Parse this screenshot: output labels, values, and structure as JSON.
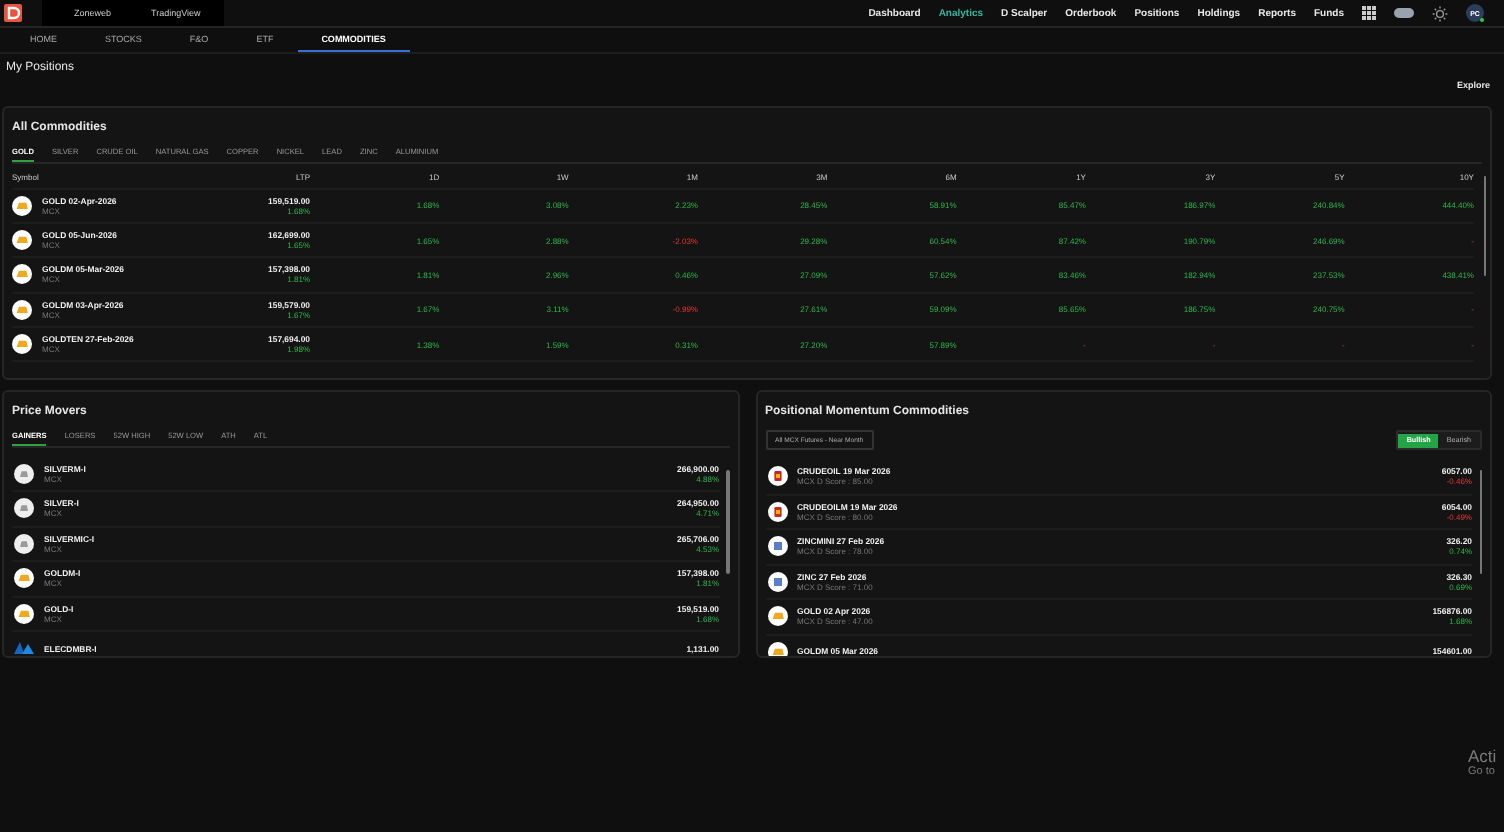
{
  "top_bar": {
    "sites": [
      "Zoneweb",
      "TradingView"
    ],
    "nav": [
      {
        "label": "Dashboard",
        "selected": false
      },
      {
        "label": "Analytics",
        "selected": true
      },
      {
        "label": "D Scalper",
        "selected": false
      },
      {
        "label": "Orderbook",
        "selected": false
      },
      {
        "label": "Positions",
        "selected": false
      },
      {
        "label": "Holdings",
        "selected": false
      },
      {
        "label": "Reports",
        "selected": false
      },
      {
        "label": "Funds",
        "selected": false
      }
    ],
    "avatar": "PC"
  },
  "sub_nav": [
    {
      "label": "HOME",
      "selected": false
    },
    {
      "label": "STOCKS",
      "selected": false
    },
    {
      "label": "F&O",
      "selected": false
    },
    {
      "label": "ETF",
      "selected": false
    },
    {
      "label": "COMMODITIES",
      "selected": true
    }
  ],
  "positions": {
    "title": "My Positions",
    "action": "Explore"
  },
  "all_commodities": {
    "title": "All Commodities",
    "tabs": [
      {
        "label": "GOLD",
        "selected": true
      },
      {
        "label": "SILVER",
        "selected": false
      },
      {
        "label": "CRUDE OIL",
        "selected": false
      },
      {
        "label": "NATURAL GAS",
        "selected": false
      },
      {
        "label": "COPPER",
        "selected": false
      },
      {
        "label": "NICKEL",
        "selected": false
      },
      {
        "label": "LEAD",
        "selected": false
      },
      {
        "label": "ZINC",
        "selected": false
      },
      {
        "label": "ALUMINIUM",
        "selected": false
      }
    ],
    "columns": [
      "Symbol",
      "LTP",
      "1D",
      "1W",
      "1M",
      "3M",
      "6M",
      "1Y",
      "3Y",
      "5Y",
      "10Y"
    ],
    "rows": [
      {
        "kind": "gold",
        "symbol": "GOLD 02-Apr-2026",
        "exchange": "MCX",
        "ltp": "159,519.00",
        "ltp_change": {
          "text": "1.68%",
          "kind": "gain"
        },
        "values": [
          {
            "text": "1.68%",
            "kind": "gain"
          },
          {
            "text": "3.08%",
            "kind": "gain"
          },
          {
            "text": "2.23%",
            "kind": "gain"
          },
          {
            "text": "28.45%",
            "kind": "gain"
          },
          {
            "text": "58.91%",
            "kind": "gain"
          },
          {
            "text": "85.47%",
            "kind": "gain"
          },
          {
            "text": "186.97%",
            "kind": "gain"
          },
          {
            "text": "240.84%",
            "kind": "gain"
          },
          {
            "text": "444.40%",
            "kind": "gain"
          }
        ]
      },
      {
        "kind": "gold",
        "symbol": "GOLD 05-Jun-2026",
        "exchange": "MCX",
        "ltp": "162,699.00",
        "ltp_change": {
          "text": "1.65%",
          "kind": "gain"
        },
        "values": [
          {
            "text": "1.65%",
            "kind": "gain"
          },
          {
            "text": "2.88%",
            "kind": "gain"
          },
          {
            "text": "-2.03%",
            "kind": "loss"
          },
          {
            "text": "29.28%",
            "kind": "gain"
          },
          {
            "text": "60.54%",
            "kind": "gain"
          },
          {
            "text": "87.42%",
            "kind": "gain"
          },
          {
            "text": "190.79%",
            "kind": "gain"
          },
          {
            "text": "246.69%",
            "kind": "gain"
          },
          {
            "text": "-",
            "kind": "loss"
          }
        ]
      },
      {
        "kind": "gold",
        "symbol": "GOLDM 05-Mar-2026",
        "exchange": "MCX",
        "ltp": "157,398.00",
        "ltp_change": {
          "text": "1.81%",
          "kind": "gain"
        },
        "values": [
          {
            "text": "1.81%",
            "kind": "gain"
          },
          {
            "text": "2.96%",
            "kind": "gain"
          },
          {
            "text": "0.46%",
            "kind": "gain"
          },
          {
            "text": "27.09%",
            "kind": "gain"
          },
          {
            "text": "57.62%",
            "kind": "gain"
          },
          {
            "text": "83.46%",
            "kind": "gain"
          },
          {
            "text": "182.94%",
            "kind": "gain"
          },
          {
            "text": "237.53%",
            "kind": "gain"
          },
          {
            "text": "438.41%",
            "kind": "gain"
          }
        ]
      },
      {
        "kind": "gold",
        "symbol": "GOLDM 03-Apr-2026",
        "exchange": "MCX",
        "ltp": "159,579.00",
        "ltp_change": {
          "text": "1.67%",
          "kind": "gain"
        },
        "values": [
          {
            "text": "1.67%",
            "kind": "gain"
          },
          {
            "text": "3.11%",
            "kind": "gain"
          },
          {
            "text": "-0.99%",
            "kind": "loss"
          },
          {
            "text": "27.61%",
            "kind": "gain"
          },
          {
            "text": "59.09%",
            "kind": "gain"
          },
          {
            "text": "85.65%",
            "kind": "gain"
          },
          {
            "text": "186.75%",
            "kind": "gain"
          },
          {
            "text": "240.75%",
            "kind": "gain"
          },
          {
            "text": "-",
            "kind": "loss"
          }
        ]
      },
      {
        "kind": "gold",
        "symbol": "GOLDTEN 27-Feb-2026",
        "exchange": "MCX",
        "ltp": "157,694.00",
        "ltp_change": {
          "text": "1.98%",
          "kind": "gain"
        },
        "values": [
          {
            "text": "1.38%",
            "kind": "gain"
          },
          {
            "text": "1.59%",
            "kind": "gain"
          },
          {
            "text": "0.31%",
            "kind": "gain"
          },
          {
            "text": "27.20%",
            "kind": "gain"
          },
          {
            "text": "57.89%",
            "kind": "gain"
          },
          {
            "text": "-",
            "kind": "loss"
          },
          {
            "text": "-",
            "kind": "loss"
          },
          {
            "text": "-",
            "kind": "loss"
          },
          {
            "text": "-",
            "kind": "loss"
          }
        ]
      }
    ]
  },
  "price_movers": {
    "title": "Price Movers",
    "tabs": [
      {
        "label": "GAINERS",
        "selected": true
      },
      {
        "label": "LOSERS",
        "selected": false
      },
      {
        "label": "52W HIGH",
        "selected": false
      },
      {
        "label": "52W LOW",
        "selected": false
      },
      {
        "label": "ATH",
        "selected": false
      },
      {
        "label": "ATL",
        "selected": false
      }
    ],
    "rows": [
      {
        "kind": "silver",
        "symbol": "SILVERM-I",
        "exchange": "MCX",
        "price": "266,900.00",
        "change": {
          "text": "4.88%",
          "kind": "gain"
        }
      },
      {
        "kind": "silver",
        "symbol": "SILVER-I",
        "exchange": "MCX",
        "price": "264,950.00",
        "change": {
          "text": "4.71%",
          "kind": "gain"
        }
      },
      {
        "kind": "silver",
        "symbol": "SILVERMIC-I",
        "exchange": "MCX",
        "price": "265,706.00",
        "change": {
          "text": "4.53%",
          "kind": "gain"
        }
      },
      {
        "kind": "gold",
        "symbol": "GOLDM-I",
        "exchange": "MCX",
        "price": "157,398.00",
        "change": {
          "text": "1.81%",
          "kind": "gain"
        }
      },
      {
        "kind": "gold",
        "symbol": "GOLD-I",
        "exchange": "MCX",
        "price": "159,519.00",
        "change": {
          "text": "1.68%",
          "kind": "gain"
        }
      },
      {
        "kind": "logo",
        "symbol": "ELECDMBR-I",
        "price": "1,131.00"
      }
    ]
  },
  "momentum": {
    "title": "Positional Momentum Commodities",
    "filter": "All MCX Futures - Near Month",
    "toggle": [
      {
        "label": "Bullish",
        "selected": true
      },
      {
        "label": "Bearish",
        "selected": false
      }
    ],
    "rows": [
      {
        "kind": "crude",
        "symbol": "CRUDEOIL 19 Mar 2026",
        "score": "MCX D Score : 85.00",
        "price": "6057.00",
        "change": {
          "text": "-0.46%",
          "kind": "loss"
        }
      },
      {
        "kind": "crude",
        "symbol": "CRUDEOILM 19 Mar 2026",
        "score": "MCX D Score : 80.00",
        "price": "6054.00",
        "change": {
          "text": "-0.49%",
          "kind": "loss"
        }
      },
      {
        "kind": "zinc",
        "symbol": "ZINCMINI 27 Feb 2026",
        "score": "MCX D Score : 78.00",
        "price": "326.20",
        "change": {
          "text": "0.74%",
          "kind": "gain"
        }
      },
      {
        "kind": "zinc",
        "symbol": "ZINC 27 Feb 2026",
        "score": "MCX D Score : 71.00",
        "price": "326.30",
        "change": {
          "text": "0.69%",
          "kind": "gain"
        }
      },
      {
        "kind": "gold",
        "symbol": "GOLD 02 Apr 2026",
        "score": "MCX D Score : 47.00",
        "price": "156876.00",
        "change": {
          "text": "1.68%",
          "kind": "gain"
        }
      },
      {
        "kind": "gold",
        "symbol": "GOLDM 05 Mar 2026",
        "price": "154601.00"
      }
    ]
  },
  "system_overlay": [
    "Acti",
    "Go to"
  ]
}
